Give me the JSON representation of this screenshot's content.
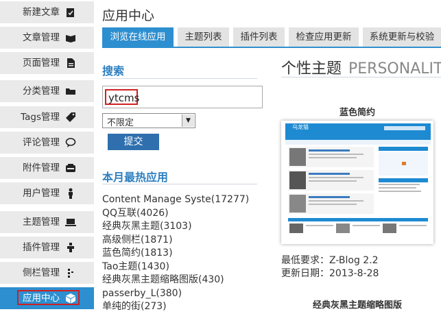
{
  "sidebar": {
    "items": [
      {
        "label": "新建文章",
        "icon": "edit-icon"
      },
      {
        "label": "文章管理",
        "icon": "book-icon"
      },
      {
        "label": "页面管理",
        "icon": "page-icon"
      },
      {
        "label": "分类管理",
        "icon": "folder-icon"
      },
      {
        "label": "Tags管理",
        "icon": "tag-icon"
      },
      {
        "label": "评论管理",
        "icon": "comment-icon"
      },
      {
        "label": "附件管理",
        "icon": "attachment-icon"
      },
      {
        "label": "用户管理",
        "icon": "user-icon"
      },
      {
        "label": "主题管理",
        "icon": "monitor-icon"
      },
      {
        "label": "插件管理",
        "icon": "plugin-icon"
      },
      {
        "label": "侧栏管理",
        "icon": "sidebar-icon"
      },
      {
        "label": "应用中心",
        "icon": "cube-icon",
        "active": true
      }
    ]
  },
  "main": {
    "title": "应用中心",
    "tabs": [
      {
        "label": "浏览在线应用",
        "active": true
      },
      {
        "label": "主题列表"
      },
      {
        "label": "插件列表"
      },
      {
        "label": "检查应用更新"
      },
      {
        "label": "系统更新与校验"
      }
    ],
    "search": {
      "title": "搜索",
      "value": "ytcms",
      "select_value": "不限定",
      "submit_label": "提交"
    },
    "hot": {
      "title": "本月最热应用",
      "items": [
        "Content Manage Syste(17277)",
        "QQ互联(4026)",
        "经典灰黑主题(3103)",
        "高级侧栏(1871)",
        "蓝色简约(1813)",
        "Tao主题(1430)",
        "经典灰黑主题缩略图版(430)",
        "passerby_L(380)",
        "单纯的街(273)"
      ]
    }
  },
  "right": {
    "section_title": "个性主题",
    "section_title_en": "PERSONALIT",
    "theme1": {
      "name": "蓝色简约",
      "logo_text": "乌龙猫",
      "min_req_label": "最低要求：",
      "min_req_value": "Z-Blog 2.2",
      "updated_label": "更新日期：",
      "updated_value": "2013-8-28"
    },
    "theme2": {
      "name": "经典灰黑主题缩略图版"
    }
  },
  "colors": {
    "accent": "#2d8fd0",
    "highlight": "#d02020",
    "button": "#2f6fae"
  }
}
